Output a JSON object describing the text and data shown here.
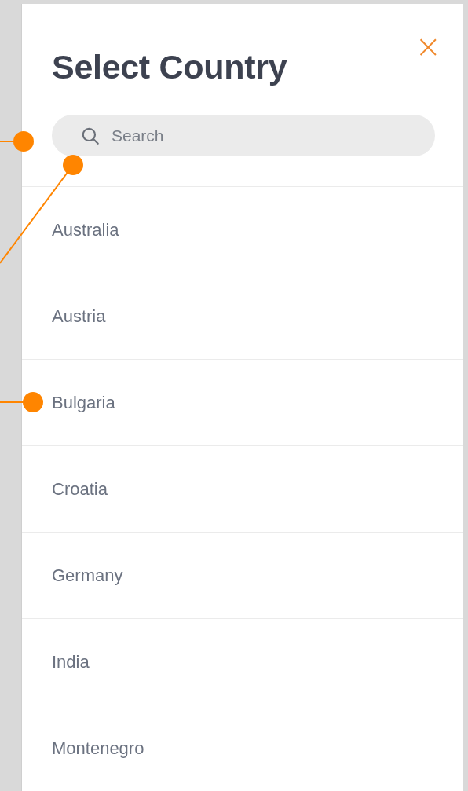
{
  "dialog": {
    "title": "Select Country",
    "close_label": "×"
  },
  "search": {
    "placeholder": "Search"
  },
  "countries": [
    {
      "name": "Australia"
    },
    {
      "name": "Austria"
    },
    {
      "name": "Bulgaria"
    },
    {
      "name": "Croatia"
    },
    {
      "name": "Germany"
    },
    {
      "name": "India"
    },
    {
      "name": "Montenegro"
    }
  ],
  "callouts": [
    {
      "kind": "horizontal"
    },
    {
      "kind": "diagonal"
    },
    {
      "kind": "horizontal"
    }
  ]
}
